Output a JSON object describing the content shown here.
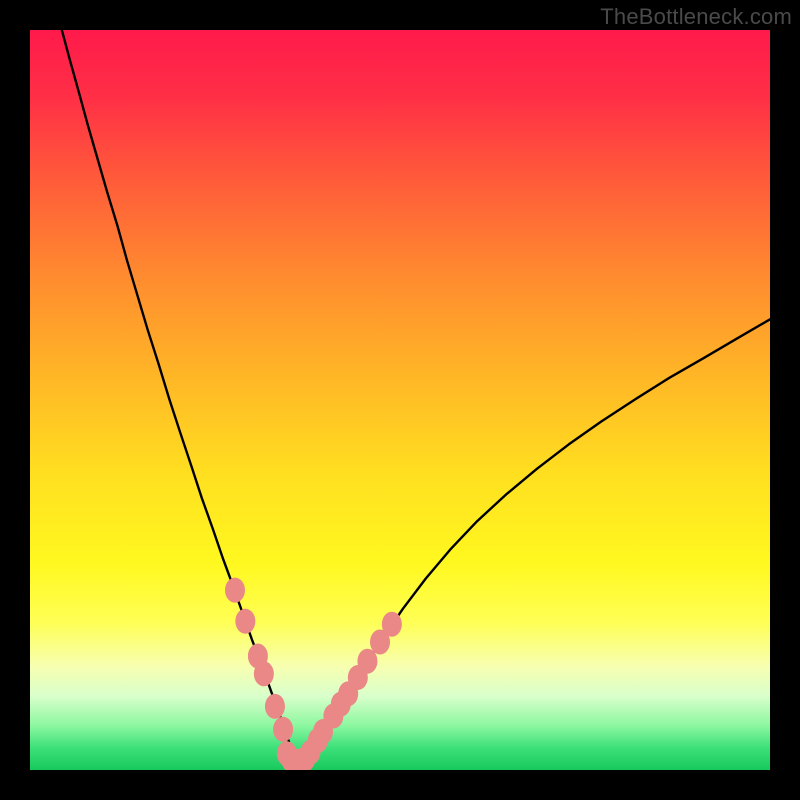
{
  "watermark": "TheBottleneck.com",
  "chart_data": {
    "type": "line",
    "title": "",
    "xlabel": "",
    "ylabel": "",
    "xlim": [
      0,
      100
    ],
    "ylim": [
      0,
      100
    ],
    "grid": false,
    "legend": false,
    "gradient_stops": [
      {
        "offset": 0.0,
        "color": "#ff1a4b"
      },
      {
        "offset": 0.09,
        "color": "#ff2f46"
      },
      {
        "offset": 0.2,
        "color": "#ff5a3a"
      },
      {
        "offset": 0.33,
        "color": "#ff8a2f"
      },
      {
        "offset": 0.47,
        "color": "#ffb726"
      },
      {
        "offset": 0.6,
        "color": "#ffdf20"
      },
      {
        "offset": 0.72,
        "color": "#fff81f"
      },
      {
        "offset": 0.8,
        "color": "#ffff55"
      },
      {
        "offset": 0.86,
        "color": "#f7ffb0"
      },
      {
        "offset": 0.9,
        "color": "#d9ffcb"
      },
      {
        "offset": 0.94,
        "color": "#8cf7a0"
      },
      {
        "offset": 0.97,
        "color": "#3de07a"
      },
      {
        "offset": 1.0,
        "color": "#18c95d"
      }
    ],
    "series": [
      {
        "name": "left-curve",
        "stroke": "#000000",
        "x": [
          4.3,
          5.4,
          6.6,
          7.8,
          9.1,
          10.4,
          11.8,
          13.1,
          14.5,
          15.9,
          17.4,
          18.8,
          20.3,
          21.8,
          23.2,
          24.7,
          26.1,
          27.5,
          28.8,
          30.0,
          31.2,
          32.2,
          33.1,
          33.9,
          34.5,
          35.0,
          35.4,
          35.8,
          36.1,
          36.4
        ],
        "y": [
          100.0,
          95.9,
          91.6,
          87.2,
          82.7,
          78.2,
          73.6,
          68.9,
          64.2,
          59.5,
          54.8,
          50.2,
          45.6,
          41.1,
          36.8,
          32.6,
          28.5,
          24.7,
          21.0,
          17.6,
          14.5,
          11.7,
          9.2,
          7.0,
          5.2,
          3.8,
          2.7,
          1.9,
          1.4,
          1.2
        ]
      },
      {
        "name": "right-curve",
        "stroke": "#000000",
        "x": [
          36.4,
          36.8,
          37.3,
          37.9,
          38.7,
          39.7,
          40.8,
          42.2,
          43.8,
          45.6,
          47.8,
          50.4,
          53.5,
          56.8,
          60.4,
          64.3,
          68.5,
          72.8,
          77.2,
          81.8,
          86.4,
          91.1,
          95.7,
          100.0
        ],
        "y": [
          1.2,
          1.4,
          1.8,
          2.5,
          3.6,
          5.0,
          6.8,
          9.0,
          11.6,
          14.6,
          18.0,
          21.8,
          25.9,
          29.8,
          33.6,
          37.2,
          40.7,
          44.0,
          47.1,
          50.1,
          53.0,
          55.7,
          58.4,
          60.9
        ]
      },
      {
        "name": "dots-left",
        "type": "scatter",
        "fill": "#e98886",
        "r": 10,
        "x": [
          27.7,
          29.1,
          30.8,
          31.6,
          33.1,
          34.2
        ],
        "y": [
          24.3,
          20.1,
          15.4,
          13.0,
          8.6,
          5.5
        ]
      },
      {
        "name": "dots-bottom",
        "type": "scatter",
        "fill": "#e98886",
        "r": 10,
        "x": [
          34.7,
          35.3,
          35.9,
          36.5,
          37.2,
          37.9
        ],
        "y": [
          2.2,
          1.4,
          1.2,
          1.2,
          1.5,
          2.4
        ]
      },
      {
        "name": "dots-right",
        "type": "scatter",
        "fill": "#e98886",
        "r": 10,
        "x": [
          38.9,
          39.6,
          41.0,
          42.0,
          43.0,
          44.3,
          45.6,
          47.3,
          48.9
        ],
        "y": [
          4.0,
          5.2,
          7.3,
          8.9,
          10.3,
          12.5,
          14.7,
          17.3,
          19.7
        ]
      }
    ]
  }
}
